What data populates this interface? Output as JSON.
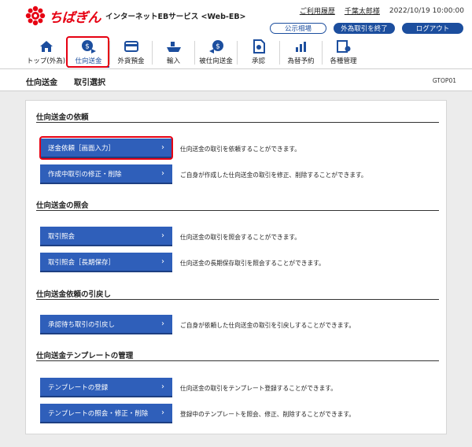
{
  "header": {
    "brand": "ちばぎん",
    "service": "インターネットEBサービス <Web-EB>",
    "links": {
      "guide": "ご利用履歴",
      "user": "千葉太郎様"
    },
    "datetime": "2022/10/19 10:00:00",
    "buttons": {
      "rates": "公示相場",
      "fx_end": "外為取引を終了",
      "logout": "ログアウト"
    },
    "brand_color": "#e60012",
    "accent_color": "#1c4e9e"
  },
  "nav": [
    {
      "label": "トップ(外為)",
      "icon": "home-icon"
    },
    {
      "label": "仕向送金",
      "icon": "remit-icon"
    },
    {
      "label": "外貨預金",
      "icon": "card-icon"
    },
    {
      "label": "輸入",
      "icon": "ship-icon"
    },
    {
      "label": "被仕向送金",
      "icon": "receive-icon"
    },
    {
      "label": "承認",
      "icon": "approve-icon"
    },
    {
      "label": "為替予約",
      "icon": "chart-icon"
    },
    {
      "label": "各種管理",
      "icon": "settings-icon"
    }
  ],
  "page": {
    "title": "仕向送金",
    "subtitle": "取引選択",
    "code": "GTOP01"
  },
  "sections": [
    {
      "title": "仕向送金の依頼",
      "actions": [
        {
          "label": "送金依頼［画面入力］",
          "desc": "仕向送金の取引を依頼することができます。"
        },
        {
          "label": "作成中取引の修正・削除",
          "desc": "ご自身が作成した仕向送金の取引を修正、削除することができます。"
        }
      ]
    },
    {
      "title": "仕向送金の照会",
      "actions": [
        {
          "label": "取引照会",
          "desc": "仕向送金の取引を照会することができます。"
        },
        {
          "label": "取引照会［長期保存］",
          "desc": "仕向送金の長期保存取引を照会することができます。"
        }
      ]
    },
    {
      "title": "仕向送金依頼の引戻し",
      "actions": [
        {
          "label": "承認待ち取引の引戻し",
          "desc": "ご自身が依頼した仕向送金の取引を引戻しすることができます。"
        }
      ]
    },
    {
      "title": "仕向送金テンプレートの管理",
      "actions": [
        {
          "label": "テンプレートの登録",
          "desc": "仕向送金の取引をテンプレート登録することができます。"
        },
        {
          "label": "テンプレートの照会・修正・削除",
          "desc": "登録中のテンプレートを照会、修正、削除することができます。"
        }
      ]
    }
  ],
  "chevron": "›"
}
